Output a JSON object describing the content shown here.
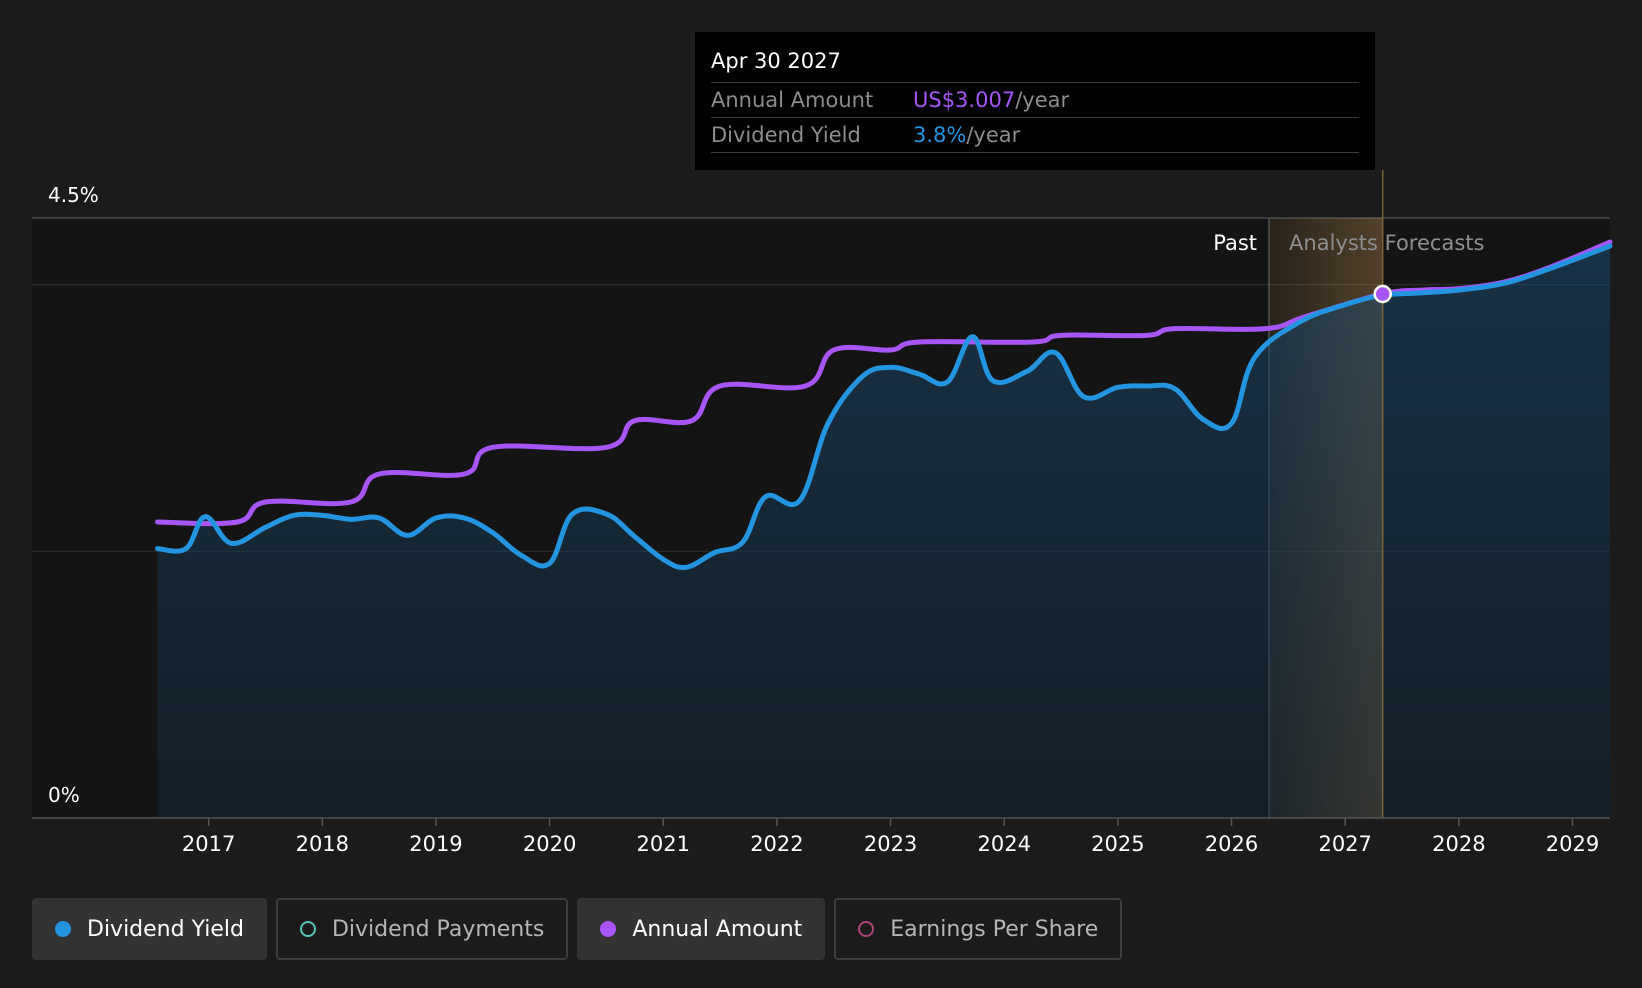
{
  "tooltip": {
    "date": "Apr 30 2027",
    "rows": [
      {
        "label": "Annual Amount",
        "value": "US$3.007",
        "unit": "/year",
        "color": "#a855f7"
      },
      {
        "label": "Dividend Yield",
        "value": "3.8%",
        "unit": "/year",
        "color": "#2394df"
      }
    ]
  },
  "legend": [
    {
      "label": "Dividend Yield",
      "color": "#2394df",
      "filled": true,
      "active": true
    },
    {
      "label": "Dividend Payments",
      "color": "#58c4b8",
      "filled": false,
      "active": false
    },
    {
      "label": "Annual Amount",
      "color": "#a855f7",
      "filled": true,
      "active": true
    },
    {
      "label": "Earnings Per Share",
      "color": "#b0457d",
      "filled": false,
      "active": false
    }
  ],
  "chart_data": {
    "type": "line",
    "y_top_label": "4.5%",
    "y_bottom_label": "0%",
    "ylim": [
      0,
      4.5
    ],
    "xlim": [
      2016.0,
      2029.33
    ],
    "x_ticks": [
      "2017",
      "2018",
      "2019",
      "2020",
      "2021",
      "2022",
      "2023",
      "2024",
      "2025",
      "2026",
      "2027",
      "2028",
      "2029"
    ],
    "region_labels": {
      "past": "Past",
      "forecast": "Analysts Forecasts"
    },
    "past_end_x": 2026.33,
    "highlight_x": 2027.33,
    "colors": {
      "yield": "#2394df",
      "amount": "#a855f7",
      "forecast": "#d6a25a"
    },
    "series": [
      {
        "name": "Dividend Yield",
        "unit": "%",
        "points": [
          [
            2016.55,
            2.02
          ],
          [
            2016.8,
            2.02
          ],
          [
            2016.97,
            2.26
          ],
          [
            2017.2,
            2.06
          ],
          [
            2017.5,
            2.18
          ],
          [
            2017.75,
            2.27
          ],
          [
            2018.0,
            2.27
          ],
          [
            2018.25,
            2.24
          ],
          [
            2018.5,
            2.25
          ],
          [
            2018.75,
            2.12
          ],
          [
            2019.0,
            2.25
          ],
          [
            2019.25,
            2.25
          ],
          [
            2019.5,
            2.14
          ],
          [
            2019.75,
            1.97
          ],
          [
            2020.0,
            1.91
          ],
          [
            2020.2,
            2.28
          ],
          [
            2020.5,
            2.28
          ],
          [
            2020.75,
            2.11
          ],
          [
            2021.0,
            1.94
          ],
          [
            2021.2,
            1.88
          ],
          [
            2021.45,
            1.99
          ],
          [
            2021.7,
            2.07
          ],
          [
            2021.9,
            2.41
          ],
          [
            2022.2,
            2.38
          ],
          [
            2022.45,
            2.96
          ],
          [
            2022.75,
            3.31
          ],
          [
            2023.0,
            3.38
          ],
          [
            2023.25,
            3.33
          ],
          [
            2023.5,
            3.27
          ],
          [
            2023.72,
            3.61
          ],
          [
            2023.9,
            3.28
          ],
          [
            2024.2,
            3.35
          ],
          [
            2024.45,
            3.49
          ],
          [
            2024.7,
            3.16
          ],
          [
            2025.0,
            3.23
          ],
          [
            2025.25,
            3.24
          ],
          [
            2025.5,
            3.22
          ],
          [
            2025.75,
            2.99
          ],
          [
            2026.0,
            2.96
          ],
          [
            2026.2,
            3.45
          ],
          [
            2026.6,
            3.72
          ],
          [
            2027.0,
            3.85
          ],
          [
            2027.33,
            3.92
          ],
          [
            2027.7,
            3.94
          ],
          [
            2028.0,
            3.96
          ],
          [
            2028.4,
            4.01
          ],
          [
            2028.8,
            4.12
          ],
          [
            2029.33,
            4.29
          ]
        ]
      },
      {
        "name": "Annual Amount",
        "unit": "US$/year",
        "points": [
          [
            2016.55,
            2.22
          ],
          [
            2017.25,
            2.22
          ],
          [
            2017.5,
            2.37
          ],
          [
            2018.25,
            2.37
          ],
          [
            2018.5,
            2.58
          ],
          [
            2019.25,
            2.58
          ],
          [
            2019.5,
            2.78
          ],
          [
            2020.5,
            2.78
          ],
          [
            2020.75,
            2.98
          ],
          [
            2021.25,
            2.98
          ],
          [
            2021.5,
            3.24
          ],
          [
            2022.25,
            3.24
          ],
          [
            2022.5,
            3.51
          ],
          [
            2023.0,
            3.51
          ],
          [
            2023.25,
            3.57
          ],
          [
            2024.25,
            3.57
          ],
          [
            2024.5,
            3.62
          ],
          [
            2025.25,
            3.62
          ],
          [
            2025.5,
            3.67
          ],
          [
            2026.3,
            3.67
          ],
          [
            2026.65,
            3.76
          ],
          [
            2027.33,
            3.93
          ],
          [
            2027.7,
            3.96
          ],
          [
            2028.0,
            3.97
          ],
          [
            2028.4,
            4.02
          ],
          [
            2028.8,
            4.13
          ],
          [
            2029.33,
            4.32
          ]
        ]
      }
    ]
  }
}
